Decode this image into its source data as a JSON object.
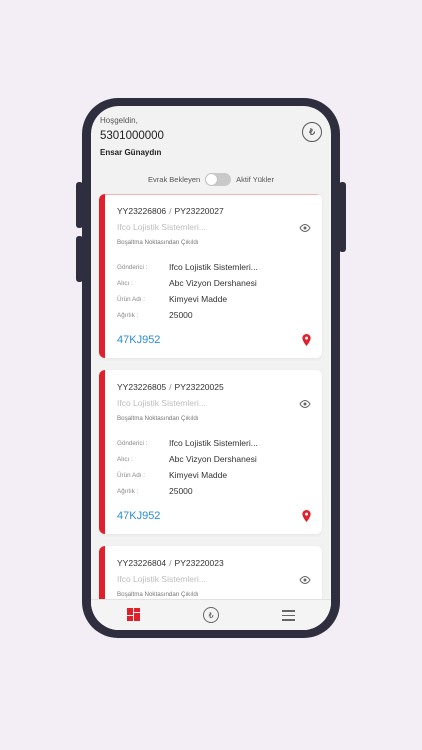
{
  "header": {
    "greeting": "Hoşgeldin,",
    "phone": "5301000000",
    "user_name": "Ensar Günaydın",
    "coin_icon": "₺"
  },
  "filter": {
    "left_label": "Evrak Bekleyen",
    "right_label": "Aktif Yükler",
    "toggle_on": false
  },
  "labels": {
    "sender": "Gönderici :",
    "receiver": "Alıcı :",
    "product": "Ürün Adı :",
    "weight": "Ağırlık :"
  },
  "cards": [
    {
      "id1": "YY23226806",
      "sep": "/",
      "id2": "PY23220027",
      "company": "Ifco Lojistik Sistemleri...",
      "status": "Boşaltma Noktasından Çıkıldı",
      "sender": "Ifco Lojistik Sistemleri...",
      "receiver": "Abc Vizyon Dershanesi",
      "product": "Kimyevi Madde",
      "weight": "25000",
      "plate": "47KJ952"
    },
    {
      "id1": "YY23226805",
      "sep": "/",
      "id2": "PY23220025",
      "company": "Ifco Lojistik Sistemleri...",
      "status": "Boşaltma Noktasından Çıkıldı",
      "sender": "Ifco Lojistik Sistemleri...",
      "receiver": "Abc Vizyon Dershanesi",
      "product": "Kimyevi Madde",
      "weight": "25000",
      "plate": "47KJ952"
    },
    {
      "id1": "YY23226804",
      "sep": "/",
      "id2": "PY23220023",
      "company": "Ifco Lojistik Sistemleri...",
      "status": "Boşaltma Noktasından Çıkıldı",
      "sender": "",
      "receiver": "",
      "product": "",
      "weight": "",
      "plate": ""
    }
  ],
  "nav": {
    "items": [
      "dashboard-icon",
      "coin-icon",
      "menu-icon"
    ],
    "coin_glyph": "₺"
  },
  "colors": {
    "accent": "#e0202b",
    "plate": "#2a8fd6",
    "background": "#f3eef5",
    "phone_frame": "#2f2e3f"
  }
}
